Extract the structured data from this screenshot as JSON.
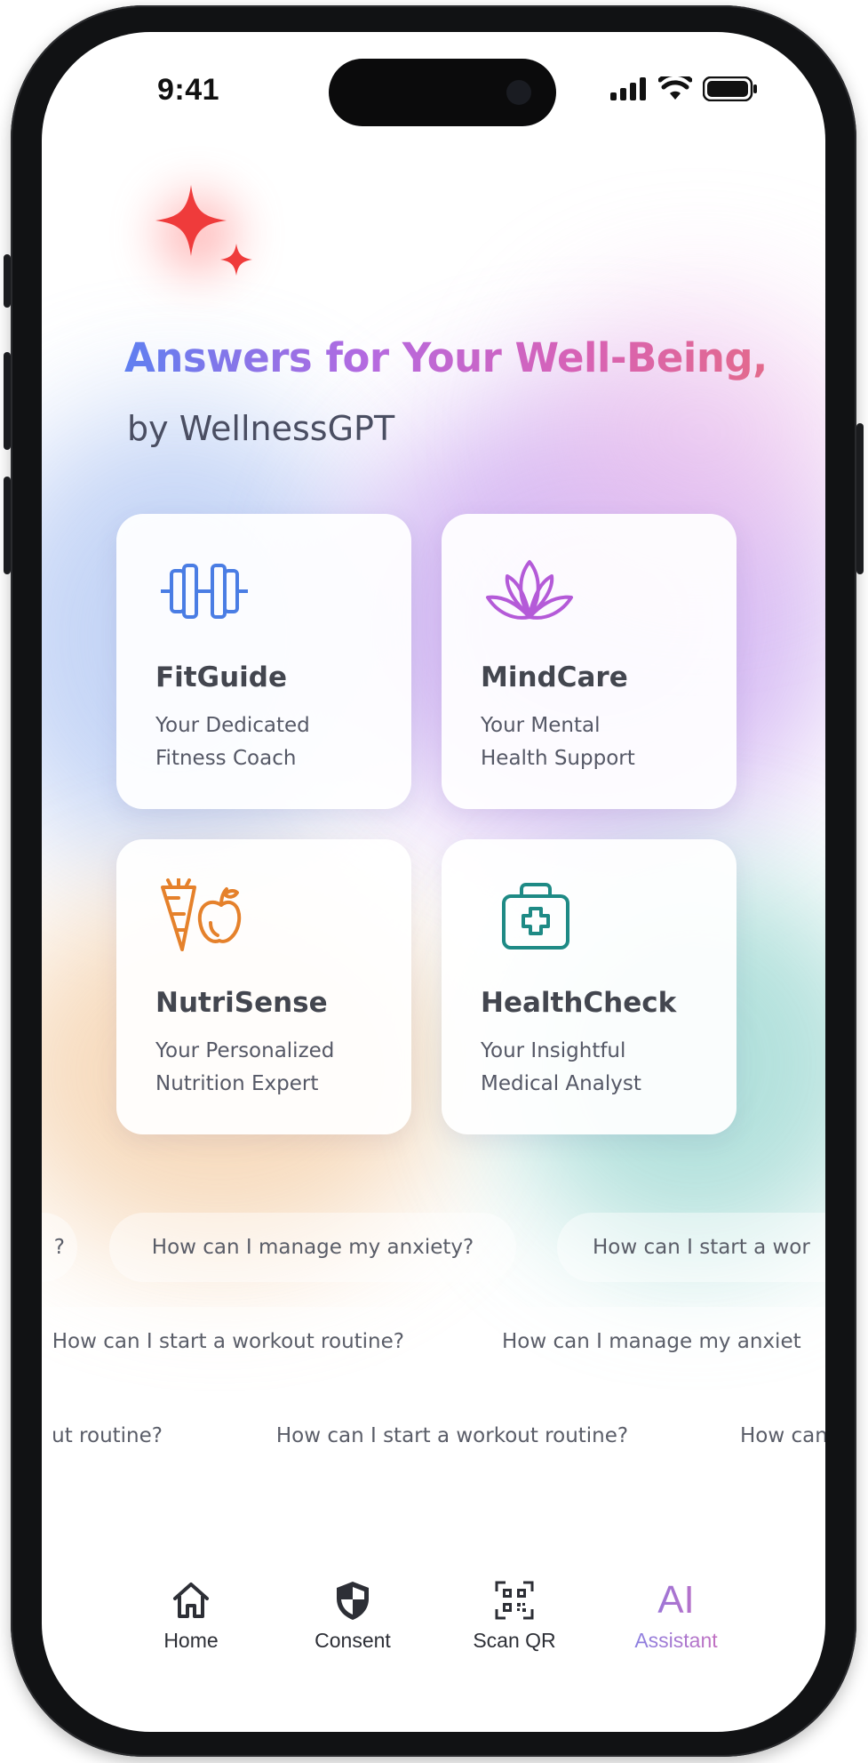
{
  "status_bar": {
    "time": "9:41",
    "icons": [
      "cellular-signal-icon",
      "wifi-icon",
      "battery-icon"
    ]
  },
  "hero": {
    "sparkle_icon": "sparkle-icon",
    "headline": "Answers for Your Well-Being,",
    "subhead": "by WellnessGPT"
  },
  "cards": [
    {
      "title": "FitGuide",
      "desc_line1": "Your Dedicated",
      "desc_line2": "Fitness Coach",
      "icon": "dumbbell-icon",
      "icon_color": "#4a7de4"
    },
    {
      "title": "MindCare",
      "desc_line1": "Your Mental",
      "desc_line2": "Health Support",
      "icon": "lotus-icon",
      "icon_color": "#b45ad8"
    },
    {
      "title": "NutriSense",
      "desc_line1": "Your Personalized",
      "desc_line2": "Nutrition Expert",
      "icon": "carrot-apple-icon",
      "icon_color": "#e5812b"
    },
    {
      "title": "HealthCheck",
      "desc_line1": "Your Insightful",
      "desc_line2": "Medical Analyst",
      "icon": "first-aid-kit-icon",
      "icon_color": "#1e8a85"
    }
  ],
  "suggestions": {
    "row1": [
      "?",
      "How can I manage my anxiety?",
      "How can I start a wor"
    ],
    "row2": [
      "How can I start a workout routine?",
      "How can I manage my anxiet"
    ],
    "row3": [
      "ut routine?",
      "How can I start a workout routine?",
      "How can"
    ]
  },
  "nav": {
    "items": [
      {
        "label": "Home",
        "icon": "home-icon",
        "active": false
      },
      {
        "label": "Consent",
        "icon": "shield-icon",
        "active": false
      },
      {
        "label": "Scan QR",
        "icon": "qr-scan-icon",
        "active": false
      },
      {
        "label": "Assistant",
        "icon_text": "AI",
        "icon": "ai-icon",
        "active": true
      }
    ]
  },
  "colors": {
    "headline_gradient": [
      "#5f7ff0",
      "#b56ae0",
      "#d762b6",
      "#e36a8c"
    ],
    "sparkle": "#ef3b3b",
    "text_dark": "#43464f"
  }
}
